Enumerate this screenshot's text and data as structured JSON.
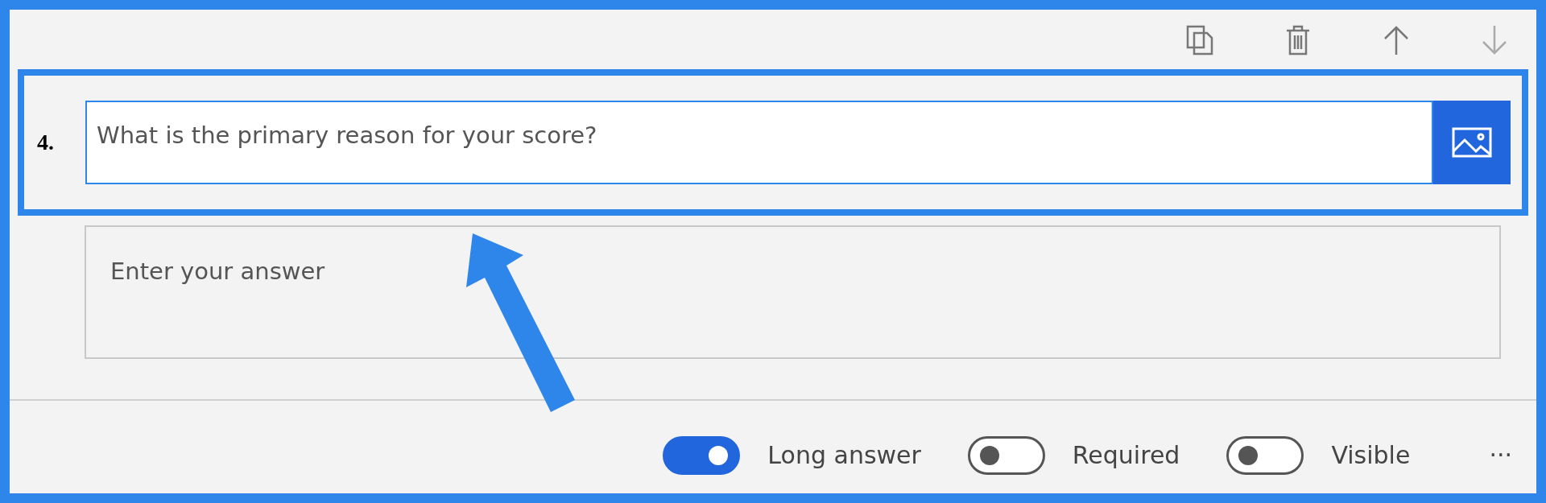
{
  "question": {
    "number": "4.",
    "text": "What is the primary reason for your score?",
    "highlighted": true
  },
  "answer": {
    "placeholder": "Enter your answer"
  },
  "options": [
    {
      "label": "Long answer",
      "on": true
    },
    {
      "label": "Required",
      "on": false
    },
    {
      "label": "Visible",
      "on": false
    }
  ],
  "more": "···"
}
